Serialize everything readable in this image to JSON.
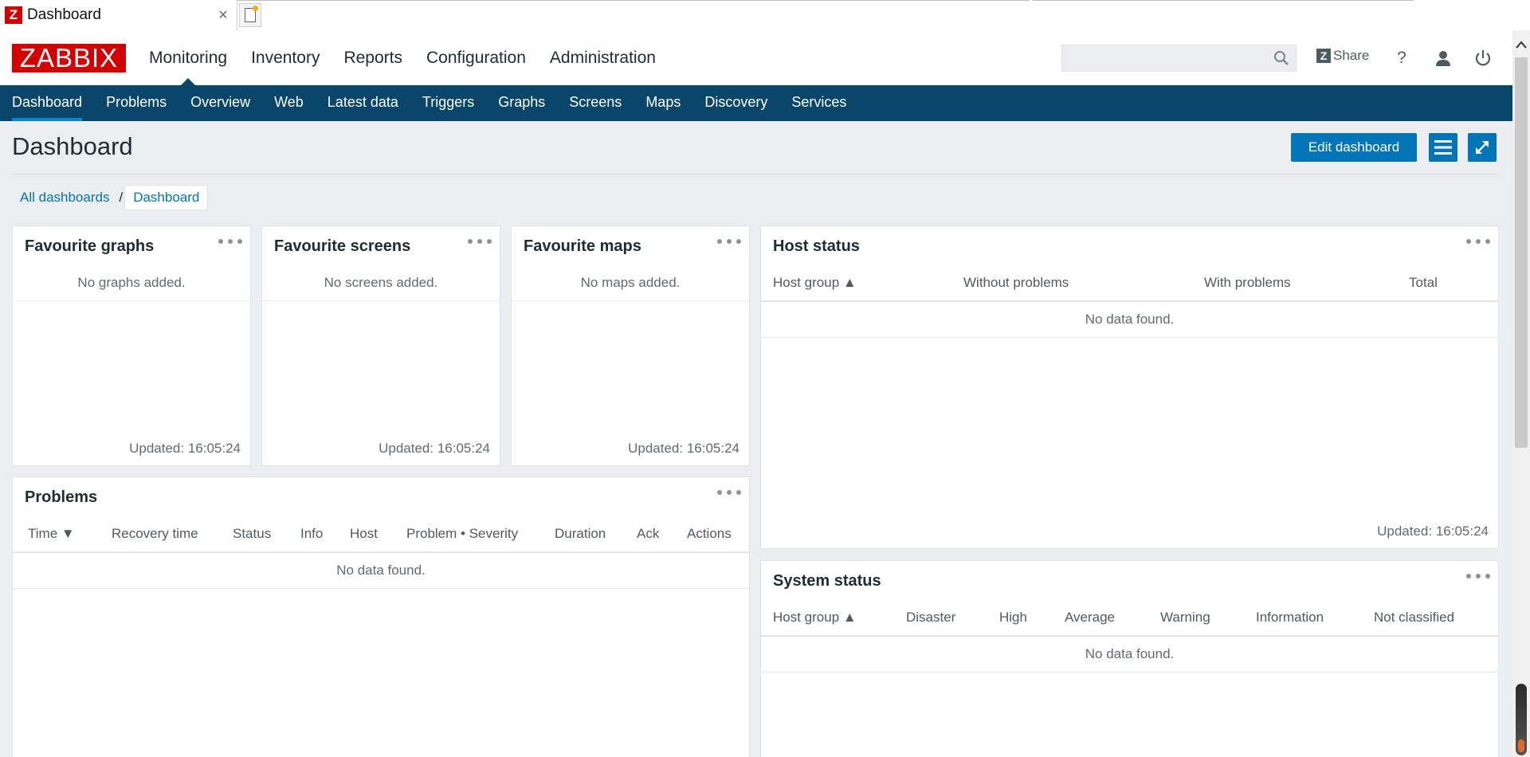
{
  "browser": {
    "tab_title": "Dashboard",
    "favicon_letter": "Z",
    "close_glyph": "×"
  },
  "header": {
    "logo_text": "ZABBIX",
    "menu": [
      "Monitoring",
      "Inventory",
      "Reports",
      "Configuration",
      "Administration"
    ],
    "active_menu": "Monitoring",
    "search_value": "",
    "share_label": "Share",
    "share_icon_letter": "Z",
    "help_glyph": "?",
    "icons": [
      "search-icon",
      "share-icon",
      "help-icon",
      "user-icon",
      "power-icon"
    ]
  },
  "subnav": {
    "items": [
      "Dashboard",
      "Problems",
      "Overview",
      "Web",
      "Latest data",
      "Triggers",
      "Graphs",
      "Screens",
      "Maps",
      "Discovery",
      "Services"
    ],
    "active": "Dashboard"
  },
  "page": {
    "title": "Dashboard",
    "edit_button": "Edit dashboard",
    "breadcrumb": {
      "all": "All dashboards",
      "separator": "/",
      "current": "Dashboard"
    }
  },
  "widgets": {
    "fav_graphs": {
      "title": "Favourite graphs",
      "empty": "No graphs added.",
      "updated": "Updated: 16:05:24"
    },
    "fav_screens": {
      "title": "Favourite screens",
      "empty": "No screens added.",
      "updated": "Updated: 16:05:24"
    },
    "fav_maps": {
      "title": "Favourite maps",
      "empty": "No maps added.",
      "updated": "Updated: 16:05:24"
    },
    "host_status": {
      "title": "Host status",
      "columns": [
        "Host group ▲",
        "Without problems",
        "With problems",
        "Total"
      ],
      "empty": "No data found.",
      "updated": "Updated: 16:05:24"
    },
    "problems": {
      "title": "Problems",
      "columns": [
        "Time ▼",
        "Recovery time",
        "Status",
        "Info",
        "Host",
        "Problem • Severity",
        "Duration",
        "Ack",
        "Actions"
      ],
      "empty": "No data found."
    },
    "system_status": {
      "title": "System status",
      "columns": [
        "Host group ▲",
        "Disaster",
        "High",
        "Average",
        "Warning",
        "Information",
        "Not classified"
      ],
      "empty": "No data found."
    }
  },
  "colors": {
    "brand_red": "#d40000",
    "nav_blue": "#0a466a",
    "button_blue": "#0275b8",
    "background": "#ebeef1"
  }
}
